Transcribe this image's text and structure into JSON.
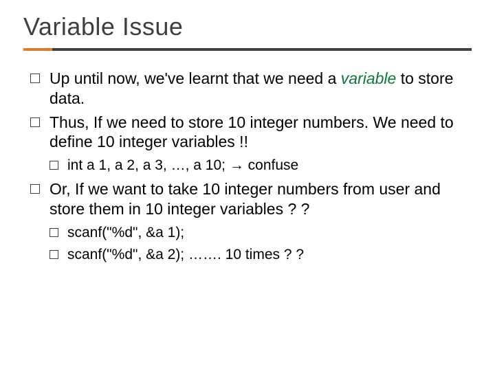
{
  "title": "Variable Issue",
  "b1_pre": "Up until now, we've learnt that we need a ",
  "b1_var": "variable",
  "b1_post": " to store data.",
  "b2": "Thus, If we need to store 10 integer numbers. We need to define 10 integer variables !!",
  "b2_sub_code": "int a 1, a 2, a 3, …,  a 10;  ",
  "b2_sub_arrow": "→",
  "b2_sub_tail": "  confuse",
  "b3": "Or, If we want to take 10 integer numbers from user and store them in 10 integer variables ? ?",
  "b3_sub1": "scanf(\"%d\", &a 1);",
  "b3_sub2_code": "scanf(\"%d\", &a 2); …….",
  "b3_sub2_tail": "   10 times ? ?"
}
